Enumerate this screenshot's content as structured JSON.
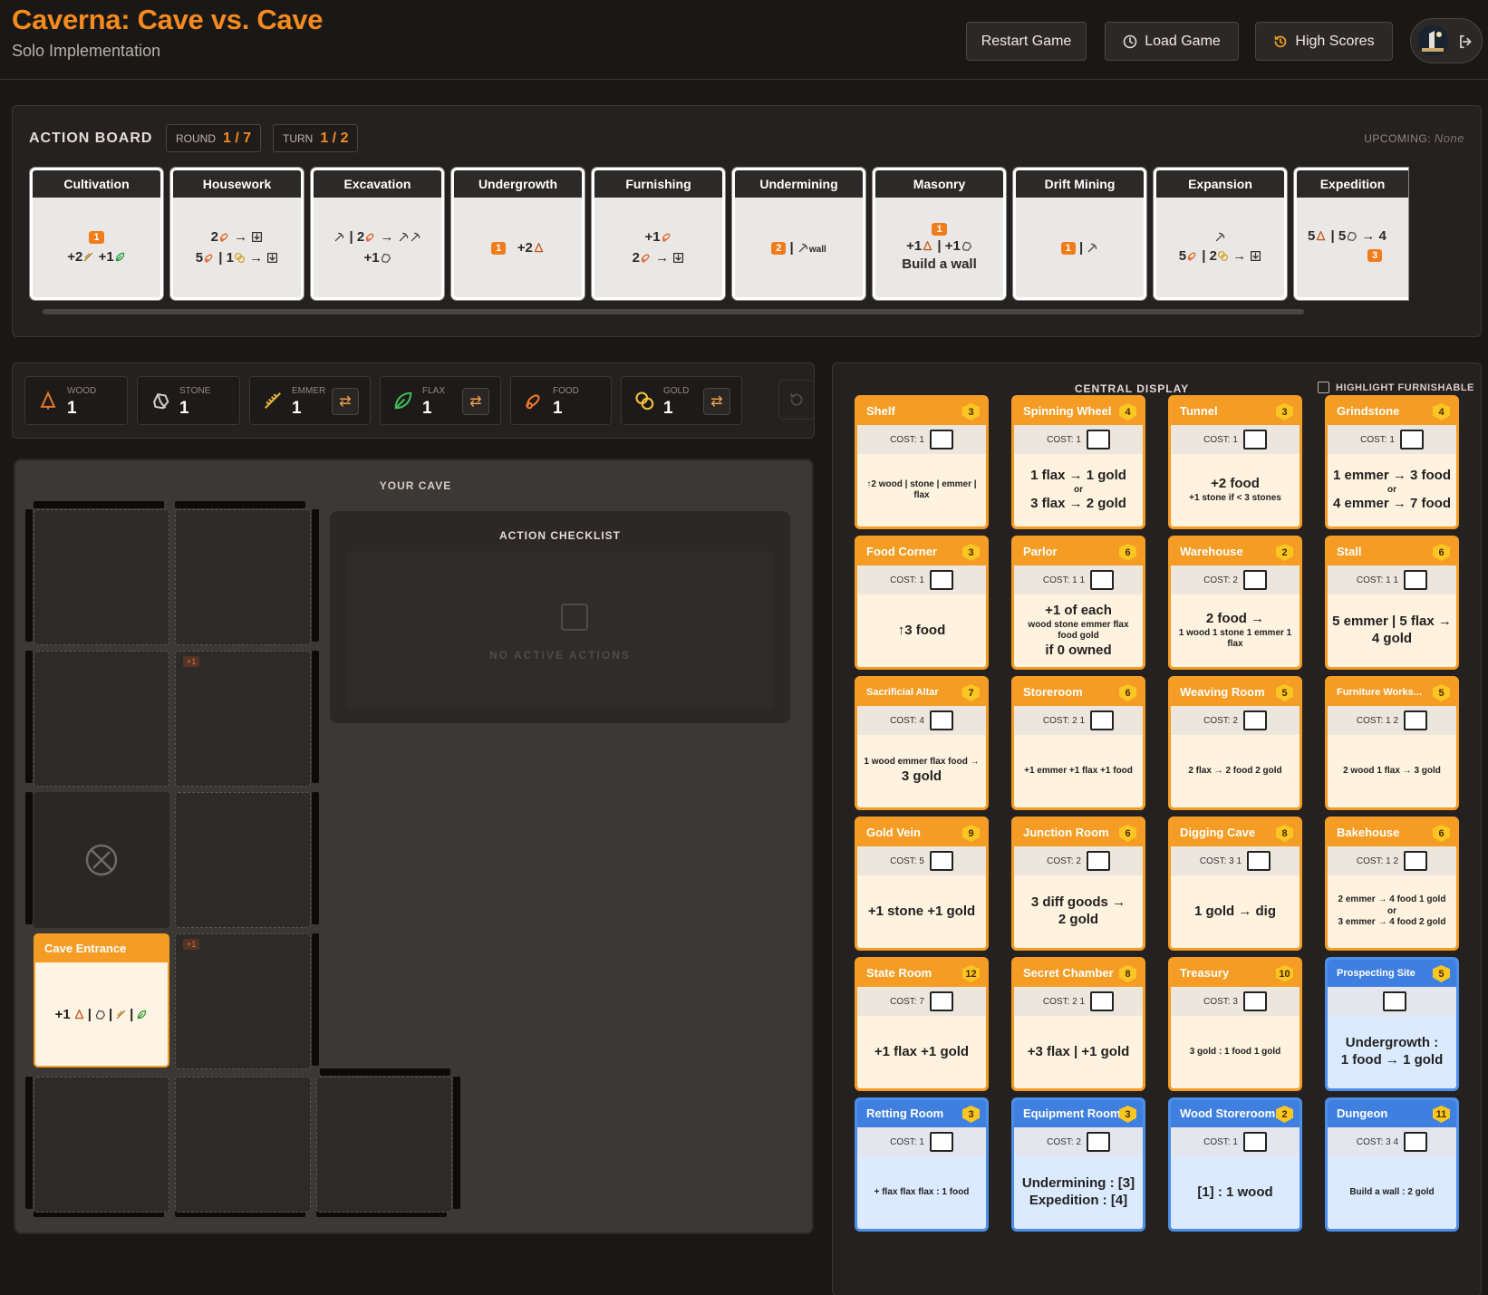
{
  "header": {
    "title": "Caverna: Cave vs. Cave",
    "subtitle": "Solo Implementation",
    "restart_label": "Restart Game",
    "load_label": "Load Game",
    "scores_label": "High Scores"
  },
  "action_board": {
    "title": "ACTION BOARD",
    "round_label": "ROUND",
    "round_value": "1 / 7",
    "turn_label": "TURN",
    "turn_value": "1 / 2",
    "upcoming_label": "UPCOMING:",
    "upcoming_value": "None",
    "actions": [
      {
        "name": "Cultivation",
        "lines": [
          "[1]",
          "+2 emmer +1 flax"
        ]
      },
      {
        "name": "Housework",
        "lines": [
          "2 food → furnish",
          "5 food | 1 gold → furnish"
        ]
      },
      {
        "name": "Excavation",
        "lines": [
          "dig | 2 food → dig dig",
          "+1 stone"
        ]
      },
      {
        "name": "Undergrowth",
        "lines": [
          "[1] +2 wood"
        ]
      },
      {
        "name": "Furnishing",
        "lines": [
          "+1 food",
          "2 food → furnish"
        ]
      },
      {
        "name": "Undermining",
        "lines": [
          "[2] | dig wall"
        ]
      },
      {
        "name": "Masonry",
        "lines": [
          "[1]",
          "+1 wood | +1 stone",
          "Build a wall"
        ]
      },
      {
        "name": "Drift Mining",
        "lines": [
          "[1] | dig"
        ]
      },
      {
        "name": "Expansion",
        "lines": [
          "dig",
          "5 food | 2 gold → furnish"
        ]
      },
      {
        "name": "Expedition",
        "lines": [
          "5 wood | 5 stone → 4",
          "[3]"
        ]
      }
    ]
  },
  "resources": [
    {
      "label": "WOOD",
      "value": "1",
      "icon": "wood-icon",
      "exchange": false
    },
    {
      "label": "STONE",
      "value": "1",
      "icon": "stone-icon",
      "exchange": false
    },
    {
      "label": "EMMER",
      "value": "1",
      "icon": "emmer-icon",
      "exchange": true
    },
    {
      "label": "FLAX",
      "value": "1",
      "icon": "flax-icon",
      "exchange": true
    },
    {
      "label": "FOOD",
      "value": "1",
      "icon": "food-icon",
      "exchange": false
    },
    {
      "label": "GOLD",
      "value": "1",
      "icon": "gold-icon",
      "exchange": true
    }
  ],
  "cave": {
    "title": "YOUR CAVE",
    "food_tag": "+1",
    "entrance": {
      "name": "Cave Entrance",
      "effect": "+1 wood | stone | emmer | flax"
    },
    "checklist_title": "ACTION CHECKLIST",
    "checklist_empty": "NO ACTIVE ACTIONS"
  },
  "central_display": {
    "title": "CENTRAL DISPLAY",
    "highlight_label": "HIGHLIGHT FURNISHABLE",
    "cards": [
      {
        "name": "Shelf",
        "points": "3",
        "cost": "COST: 1",
        "effect": [
          "↑2 wood | stone | emmer | flax"
        ],
        "blue": false
      },
      {
        "name": "Spinning Wheel",
        "points": "4",
        "cost": "COST: 1",
        "effect": [
          "1 flax → 1 gold",
          "or",
          "3 flax → 2 gold"
        ],
        "blue": false
      },
      {
        "name": "Tunnel",
        "points": "3",
        "cost": "COST: 1",
        "effect": [
          "+2 food",
          "+1 stone if < 3 stones"
        ],
        "blue": false
      },
      {
        "name": "Grindstone",
        "points": "4",
        "cost": "COST: 1",
        "effect": [
          "1 emmer → 3 food",
          "or",
          "4 emmer → 7 food"
        ],
        "blue": false
      },
      {
        "name": "Food Corner",
        "points": "3",
        "cost": "COST: 1",
        "effect": [
          "↑3 food"
        ],
        "blue": false
      },
      {
        "name": "Parlor",
        "points": "6",
        "cost": "COST: 1  1",
        "effect": [
          "+1 of each",
          "wood stone emmer flax food gold",
          "if 0 owned"
        ],
        "blue": false
      },
      {
        "name": "Warehouse",
        "points": "2",
        "cost": "COST: 2",
        "effect": [
          "2 food →",
          "1 wood 1 stone 1 emmer 1 flax"
        ],
        "blue": false
      },
      {
        "name": "Stall",
        "points": "6",
        "cost": "COST: 1  1",
        "effect": [
          "5 emmer | 5 flax →",
          "4 gold"
        ],
        "blue": false
      },
      {
        "name": "Sacrificial Altar",
        "points": "7",
        "cost": "COST: 4",
        "effect": [
          "1 wood emmer flax food →",
          "3 gold"
        ],
        "blue": false
      },
      {
        "name": "Storeroom",
        "points": "6",
        "cost": "COST: 2  1",
        "effect": [
          "+1 emmer +1 flax +1 food"
        ],
        "blue": false
      },
      {
        "name": "Weaving Room",
        "points": "5",
        "cost": "COST: 2",
        "effect": [
          "2 flax → 2 food 2 gold"
        ],
        "blue": false
      },
      {
        "name": "Furniture Works...",
        "points": "5",
        "cost": "COST: 1  2",
        "effect": [
          "2 wood 1 flax → 3 gold"
        ],
        "blue": false
      },
      {
        "name": "Gold Vein",
        "points": "9",
        "cost": "COST: 5",
        "effect": [
          "+1 stone  +1 gold"
        ],
        "blue": false
      },
      {
        "name": "Junction Room",
        "points": "6",
        "cost": "COST: 2",
        "effect": [
          "3 diff goods →",
          "2 gold"
        ],
        "blue": false
      },
      {
        "name": "Digging Cave",
        "points": "8",
        "cost": "COST: 3  1",
        "effect": [
          "1 gold → dig"
        ],
        "blue": false
      },
      {
        "name": "Bakehouse",
        "points": "6",
        "cost": "COST: 1  2",
        "effect": [
          "2 emmer → 4 food 1 gold",
          "or",
          "3 emmer → 4 food 2 gold"
        ],
        "blue": false
      },
      {
        "name": "State Room",
        "points": "12",
        "cost": "COST: 7",
        "effect": [
          "+1 flax  +1 gold"
        ],
        "blue": false
      },
      {
        "name": "Secret Chamber",
        "points": "8",
        "cost": "COST: 2  1",
        "effect": [
          "+3 flax | +1 gold"
        ],
        "blue": false
      },
      {
        "name": "Treasury",
        "points": "10",
        "cost": "COST: 3",
        "effect": [
          "3 gold : 1 food 1 gold"
        ],
        "blue": false
      },
      {
        "name": "Prospecting Site",
        "points": "5",
        "cost": "",
        "effect": [
          "Undergrowth :",
          "1 food → 1 gold"
        ],
        "blue": true
      },
      {
        "name": "Retting Room",
        "points": "3",
        "cost": "COST: 1",
        "effect": [
          "+ flax flax flax : 1 food"
        ],
        "blue": true
      },
      {
        "name": "Equipment Room",
        "points": "3",
        "cost": "COST: 2",
        "effect": [
          "Undermining : [3]",
          "Expedition : [4]"
        ],
        "blue": true
      },
      {
        "name": "Wood Storeroom",
        "points": "2",
        "cost": "COST: 1",
        "effect": [
          "[1] : 1 wood"
        ],
        "blue": true
      },
      {
        "name": "Dungeon",
        "points": "11",
        "cost": "COST: 3  4",
        "effect": [
          "Build a wall : 2 gold"
        ],
        "blue": true
      }
    ]
  },
  "colors": {
    "accent": "#f58a1f",
    "card_orange": "#f59c24",
    "card_blue": "#3f7fe0",
    "background": "#1a1817"
  }
}
